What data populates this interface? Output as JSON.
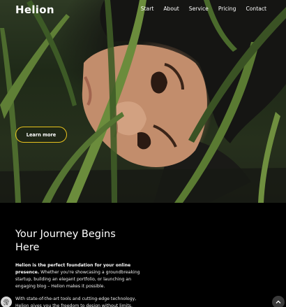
{
  "brand": {
    "logo_text": "Helion"
  },
  "nav": {
    "items": [
      {
        "label": "Start"
      },
      {
        "label": "About"
      },
      {
        "label": "Service"
      },
      {
        "label": "Pricing"
      },
      {
        "label": "Contact"
      }
    ]
  },
  "hero": {
    "image_icon": "portrait-photo-woman-in-grass",
    "cta_label": "Learn more",
    "accent_color": "#e8c21d"
  },
  "intro": {
    "heading_line1": "Your Journey Begins",
    "heading_line2": "Here",
    "para1_strong": "Helion is the perfect foundation for your online presence.",
    "para1_rest": " Whether you're showcasing a groundbreaking startup, building an elegant portfolio, or launching an engaging blog – Helion makes it possible.",
    "para2": "With state-of-the-art tools and cutting-edge technology, Helion gives you the freedom to design without limits."
  },
  "floating": {
    "cookie_icon": "fingerprint-icon",
    "scroll_icon": "chevron-up-icon"
  }
}
